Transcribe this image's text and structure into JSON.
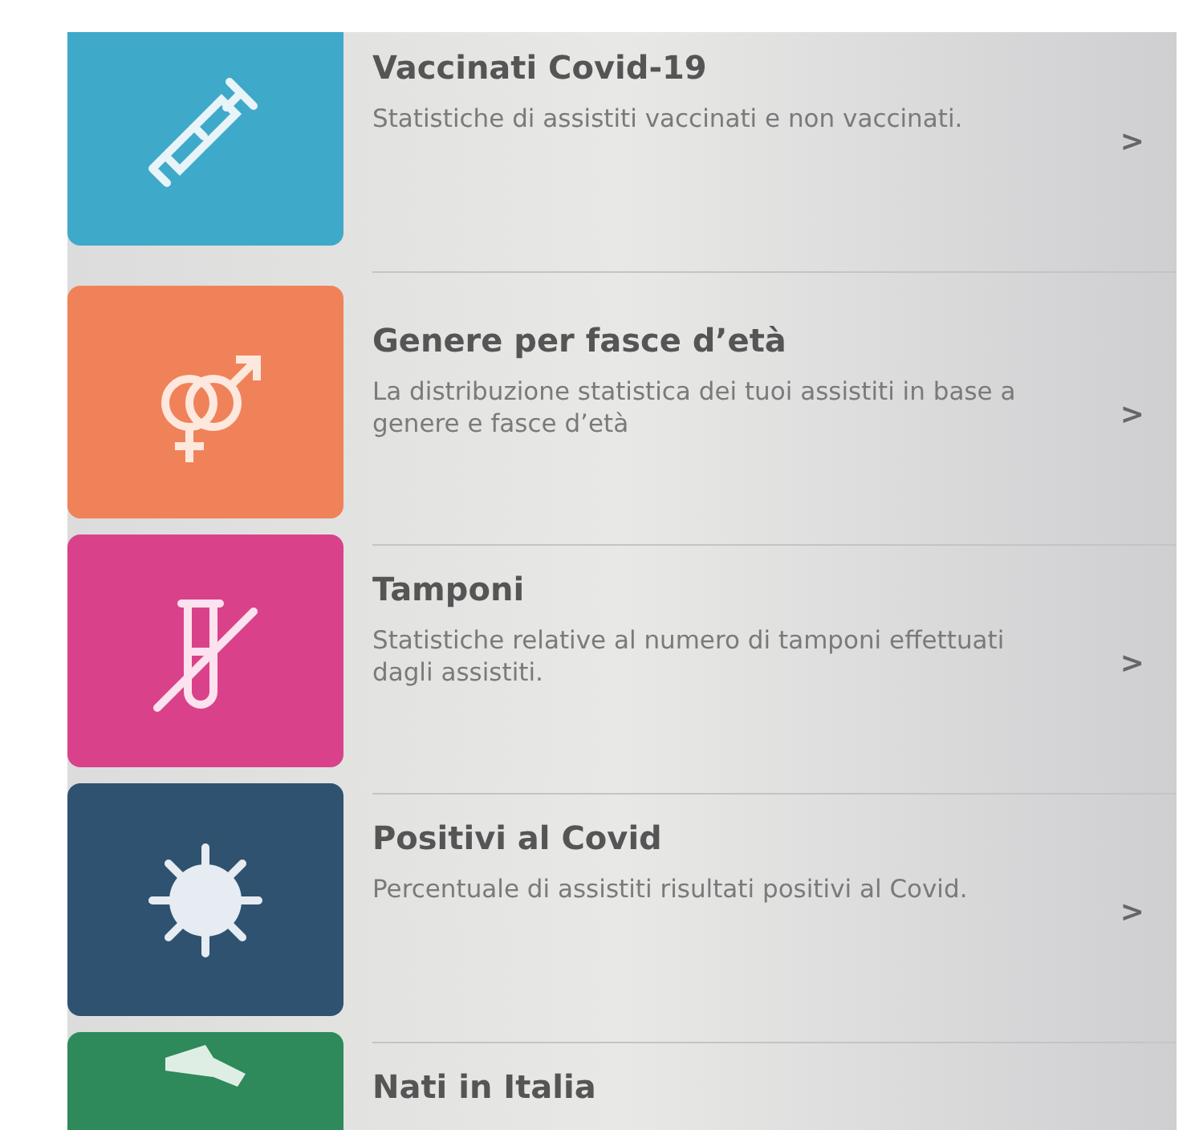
{
  "items": [
    {
      "kind": "syringe",
      "color": "#3fa9c9",
      "title": "Vaccinati Covid-19",
      "description": "Statistiche di assistiti vaccinati e non vaccinati.",
      "arrow": ">"
    },
    {
      "kind": "gender",
      "color": "#f0825a",
      "title": "Genere per fasce d’età",
      "description": "La distribuzione statistica dei tuoi assistiti in base a genere e fasce d’età",
      "arrow": ">"
    },
    {
      "kind": "tube",
      "color": "#d9428a",
      "title": "Tamponi",
      "description": "Statistiche relative al numero di tamponi effettuati dagli assistiti.",
      "arrow": ">"
    },
    {
      "kind": "virus",
      "color": "#2f5270",
      "title": "Positivi al Covid",
      "description": "Percentuale di assistiti risultati positivi al Covid.",
      "arrow": ">"
    },
    {
      "kind": "map",
      "color": "#2e8a5a",
      "title": "Nati in Italia"
    }
  ]
}
